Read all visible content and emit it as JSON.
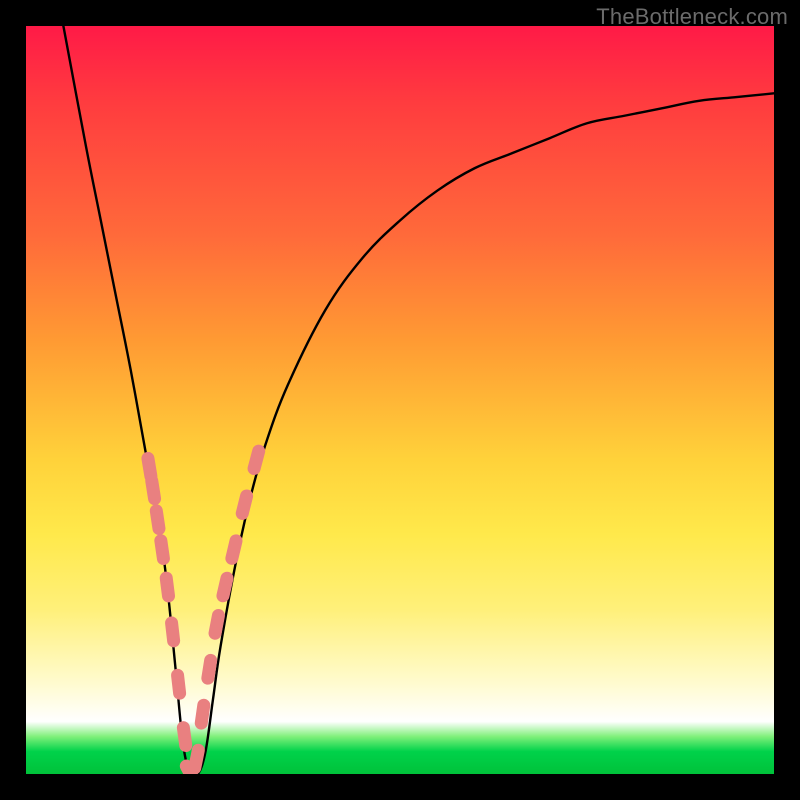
{
  "watermark": "TheBottleneck.com",
  "colors": {
    "frame": "#000000",
    "curve": "#000000",
    "marker": "#e98080",
    "gradient_top": "#ff1a47",
    "gradient_bottom": "#00c23a"
  },
  "chart_data": {
    "type": "line",
    "title": "",
    "xlabel": "",
    "ylabel": "",
    "xlim": [
      0,
      100
    ],
    "ylim": [
      0,
      100
    ],
    "grid": false,
    "legend": false,
    "series": [
      {
        "name": "bottleneck-curve",
        "x": [
          5,
          8,
          10,
          12,
          14,
          16,
          17,
          18,
          19,
          20,
          21,
          22,
          23,
          24,
          25,
          26,
          28,
          30,
          32,
          35,
          40,
          45,
          50,
          55,
          60,
          65,
          70,
          75,
          80,
          85,
          90,
          95,
          100
        ],
        "values": [
          100,
          84,
          74,
          64,
          54,
          43,
          38,
          32,
          24,
          14,
          4,
          0,
          0,
          3,
          10,
          17,
          28,
          37,
          44,
          52,
          62,
          69,
          74,
          78,
          81,
          83,
          85,
          87,
          88,
          89,
          90,
          90.5,
          91
        ]
      }
    ],
    "markers": {
      "name": "highlighted-points",
      "x": [
        16.5,
        17.0,
        17.6,
        18.2,
        18.9,
        19.6,
        20.4,
        21.2,
        22.0,
        22.8,
        23.6,
        24.5,
        25.5,
        26.6,
        27.8,
        29.2,
        30.8
      ],
      "values": [
        41,
        38,
        34,
        30,
        25,
        19,
        12,
        5,
        0,
        2,
        8,
        14,
        20,
        25,
        30,
        36,
        42
      ]
    }
  }
}
